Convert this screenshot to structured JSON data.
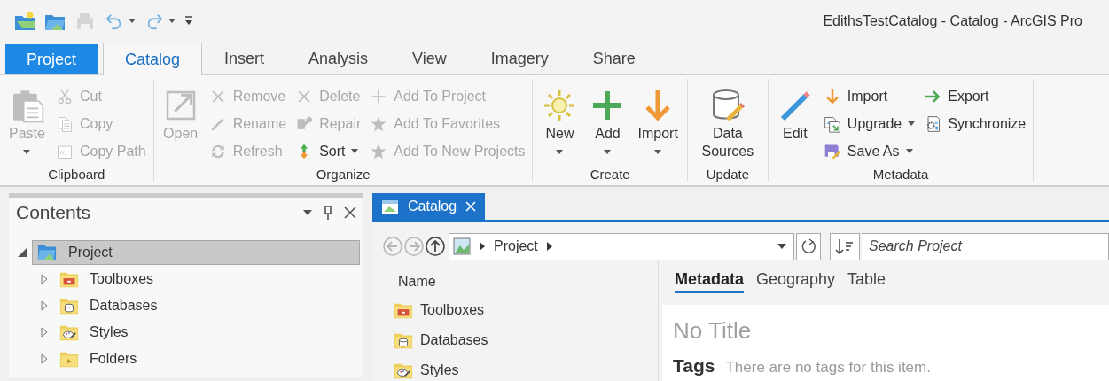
{
  "window": {
    "title": "EdithsTestCatalog - Catalog - ArcGIS Pro"
  },
  "quick_access": [
    {
      "disabled": false
    },
    {
      "disabled": false
    },
    {
      "disabled": true
    },
    {
      "disabled": false,
      "dropdown": true
    },
    {
      "disabled": false,
      "dropdown": true
    },
    {
      "disabled": false
    }
  ],
  "tabs": [
    {
      "label": "Project",
      "kind": "backstage",
      "selected": false
    },
    {
      "label": "Catalog",
      "kind": "tab",
      "selected": true
    },
    {
      "label": "Insert",
      "kind": "tab",
      "selected": false
    },
    {
      "label": "Analysis",
      "kind": "tab",
      "selected": false
    },
    {
      "label": "View",
      "kind": "tab",
      "selected": false
    },
    {
      "label": "Imagery",
      "kind": "tab",
      "selected": false
    },
    {
      "label": "Share",
      "kind": "tab",
      "selected": false
    }
  ],
  "ribbon": {
    "groups": [
      {
        "label": "Clipboard",
        "items": [
          {
            "kind": "large",
            "label": "Paste",
            "disabled": true,
            "dropdown": true
          },
          {
            "kind": "small",
            "label": "Cut",
            "disabled": true
          },
          {
            "kind": "small",
            "label": "Copy",
            "disabled": true
          },
          {
            "kind": "small",
            "label": "Copy Path",
            "disabled": true
          }
        ]
      },
      {
        "label": "Organize",
        "items": [
          {
            "kind": "large",
            "label": "Open",
            "disabled": true
          },
          {
            "kind": "small",
            "label": "Remove",
            "disabled": true
          },
          {
            "kind": "small",
            "label": "Rename",
            "disabled": true
          },
          {
            "kind": "small",
            "label": "Refresh",
            "disabled": true
          },
          {
            "kind": "small",
            "label": "Delete",
            "disabled": true
          },
          {
            "kind": "small",
            "label": "Repair",
            "disabled": true
          },
          {
            "kind": "small",
            "label": "Sort",
            "disabled": false,
            "dropdown": true
          },
          {
            "kind": "small",
            "label": "Add To Project",
            "disabled": true
          },
          {
            "kind": "small",
            "label": "Add To Favorites",
            "disabled": true
          },
          {
            "kind": "small",
            "label": "Add To New Projects",
            "disabled": true
          }
        ]
      },
      {
        "label": "Create",
        "items": [
          {
            "kind": "large",
            "label": "New",
            "disabled": false,
            "dropdown": true
          },
          {
            "kind": "large",
            "label": "Add",
            "disabled": false,
            "dropdown": true
          },
          {
            "kind": "large",
            "label": "Import",
            "disabled": false,
            "dropdown": true
          }
        ]
      },
      {
        "label": "Update",
        "items": [
          {
            "kind": "large",
            "label": "Data Sources",
            "disabled": false
          }
        ]
      },
      {
        "label": "Metadata",
        "items": [
          {
            "kind": "large",
            "label": "Edit",
            "disabled": false
          },
          {
            "kind": "small",
            "label": "Import",
            "disabled": false
          },
          {
            "kind": "small",
            "label": "Upgrade",
            "disabled": false,
            "dropdown": true
          },
          {
            "kind": "small",
            "label": "Save As",
            "disabled": false,
            "dropdown": true
          },
          {
            "kind": "small",
            "label": "Export",
            "disabled": false
          },
          {
            "kind": "small",
            "label": "Synchronize",
            "disabled": false
          }
        ]
      }
    ]
  },
  "contents": {
    "title": "Contents",
    "tree": [
      {
        "label": "Project",
        "expanded": true,
        "selected": true,
        "children": [
          {
            "label": "Toolboxes",
            "expanded": false,
            "selected": false
          },
          {
            "label": "Databases",
            "expanded": false,
            "selected": false
          },
          {
            "label": "Styles",
            "expanded": false,
            "selected": false
          },
          {
            "label": "Folders",
            "expanded": false,
            "selected": false
          }
        ]
      }
    ]
  },
  "catalog_view": {
    "tab": {
      "label": "Catalog",
      "selected": true
    },
    "nav": [
      {
        "disabled": true
      },
      {
        "disabled": true
      },
      {
        "disabled": false
      }
    ],
    "breadcrumb": [
      "Project"
    ],
    "search": {
      "placeholder": "Search Project"
    },
    "list": {
      "column": "Name",
      "items": [
        "Toolboxes",
        "Databases",
        "Styles"
      ]
    },
    "detail_tabs": [
      {
        "label": "Metadata",
        "selected": true
      },
      {
        "label": "Geography",
        "selected": false
      },
      {
        "label": "Table",
        "selected": false
      }
    ],
    "metadata": {
      "title": "No Title",
      "tags_label": "Tags",
      "tags_text": "There are no tags for this item."
    }
  }
}
